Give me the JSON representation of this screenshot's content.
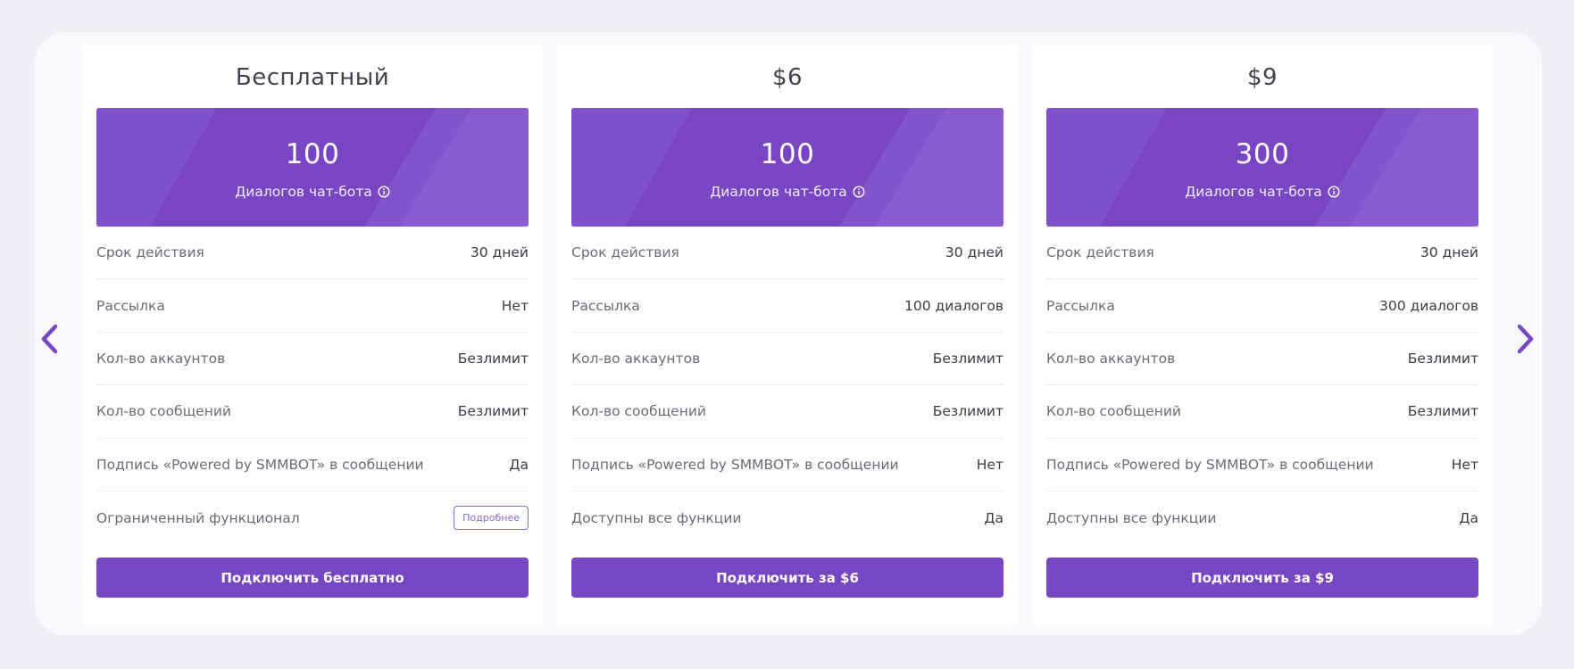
{
  "colors": {
    "page_bg": "#f0eef9",
    "accent": "#7746c2",
    "banner": "#7a4cc8"
  },
  "navigation": {
    "prev_icon": "chevron-left-icon",
    "next_icon": "chevron-right-icon"
  },
  "plans": [
    {
      "title": "Бесплатный",
      "dialogs": "100",
      "dialogs_label": "Диалогов чат-бота",
      "rows": [
        {
          "label": "Срок действия",
          "value": "30 дней"
        },
        {
          "label": "Рассылка",
          "value": "Нет"
        },
        {
          "label": "Кол-во аккаунтов",
          "value": "Безлимит"
        },
        {
          "label": "Кол-во сообщений",
          "value": "Безлимит"
        },
        {
          "label": "Подпись «Powered by SMMBOT» в сообщении",
          "value": "Да"
        },
        {
          "label": "Ограниченный функционал",
          "value": "Подробнее"
        }
      ],
      "button": "Подключить бесплатно"
    },
    {
      "title": "$6",
      "dialogs": "100",
      "dialogs_label": "Диалогов чат-бота",
      "rows": [
        {
          "label": "Срок действия",
          "value": "30 дней"
        },
        {
          "label": "Рассылка",
          "value": "100 диалогов"
        },
        {
          "label": "Кол-во аккаунтов",
          "value": "Безлимит"
        },
        {
          "label": "Кол-во сообщений",
          "value": "Безлимит"
        },
        {
          "label": "Подпись «Powered by SMMBOT» в сообщении",
          "value": "Нет"
        },
        {
          "label": "Доступны все функции",
          "value": "Да"
        }
      ],
      "button": "Подключить за $6"
    },
    {
      "title": "$9",
      "dialogs": "300",
      "dialogs_label": "Диалогов чат-бота",
      "rows": [
        {
          "label": "Срок действия",
          "value": "30 дней"
        },
        {
          "label": "Рассылка",
          "value": "300 диалогов"
        },
        {
          "label": "Кол-во аккаунтов",
          "value": "Безлимит"
        },
        {
          "label": "Кол-во сообщений",
          "value": "Безлимит"
        },
        {
          "label": "Подпись «Powered by SMMBOT» в сообщении",
          "value": "Нет"
        },
        {
          "label": "Доступны все функции",
          "value": "Да"
        }
      ],
      "button": "Подключить за $9"
    }
  ]
}
